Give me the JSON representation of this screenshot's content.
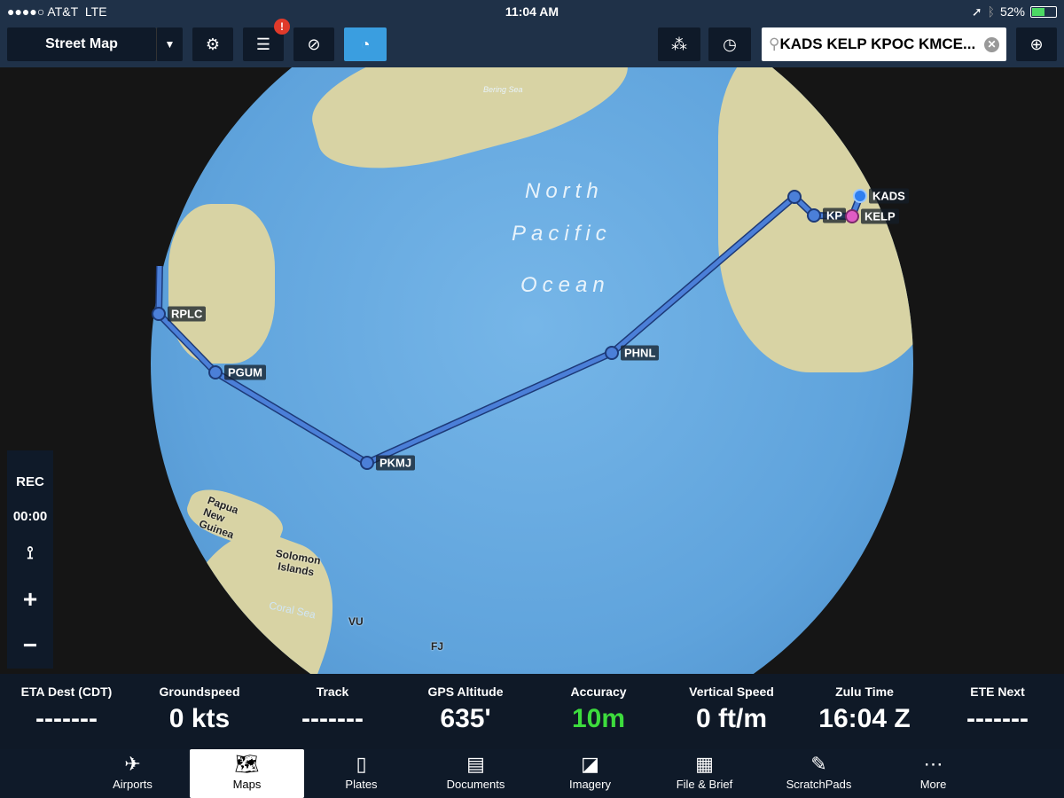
{
  "status": {
    "carrier": "●●●●○ AT&T",
    "network": "LTE",
    "time": "11:04 AM",
    "battery": "52%",
    "battery_level": 0.52
  },
  "toolbar": {
    "map_type": "Street Map",
    "alert_badge": "!",
    "search_value": "KADS KELP KPOC KMCE...",
    "active_color": "#3a9ee0"
  },
  "map": {
    "ocean_label": [
      "North",
      "Pacific",
      "Ocean"
    ],
    "places": [
      "Bering Sea",
      "Papua New Guinea",
      "Solomon Islands",
      "Coral Sea",
      "VU",
      "FJ"
    ],
    "waypoints": [
      "RPLC",
      "PGUM",
      "PKMJ",
      "PHNL",
      "KP",
      "KELP",
      "KADS"
    ],
    "route_color": "#3b6fd6",
    "destination_color": "#e05cc4"
  },
  "side": {
    "rec": "REC",
    "timer": "00:00"
  },
  "instruments": [
    {
      "label": "ETA Dest (CDT)",
      "value": "-------"
    },
    {
      "label": "Groundspeed",
      "value": "0 kts"
    },
    {
      "label": "Track",
      "value": "-------"
    },
    {
      "label": "GPS Altitude",
      "value": "635'"
    },
    {
      "label": "Accuracy",
      "value": "10m",
      "color": "#3ddc3d"
    },
    {
      "label": "Vertical Speed",
      "value": "0 ft/m"
    },
    {
      "label": "Zulu Time",
      "value": "16:04 Z"
    },
    {
      "label": "ETE Next",
      "value": "-------"
    }
  ],
  "tabs": [
    {
      "label": "Airports",
      "icon": "airport-icon"
    },
    {
      "label": "Maps",
      "icon": "map-icon",
      "active": true
    },
    {
      "label": "Plates",
      "icon": "plates-icon"
    },
    {
      "label": "Documents",
      "icon": "documents-icon"
    },
    {
      "label": "Imagery",
      "icon": "imagery-icon"
    },
    {
      "label": "File & Brief",
      "icon": "file-brief-icon"
    },
    {
      "label": "ScratchPads",
      "icon": "scratchpad-icon"
    },
    {
      "label": "More",
      "icon": "more-icon"
    }
  ]
}
